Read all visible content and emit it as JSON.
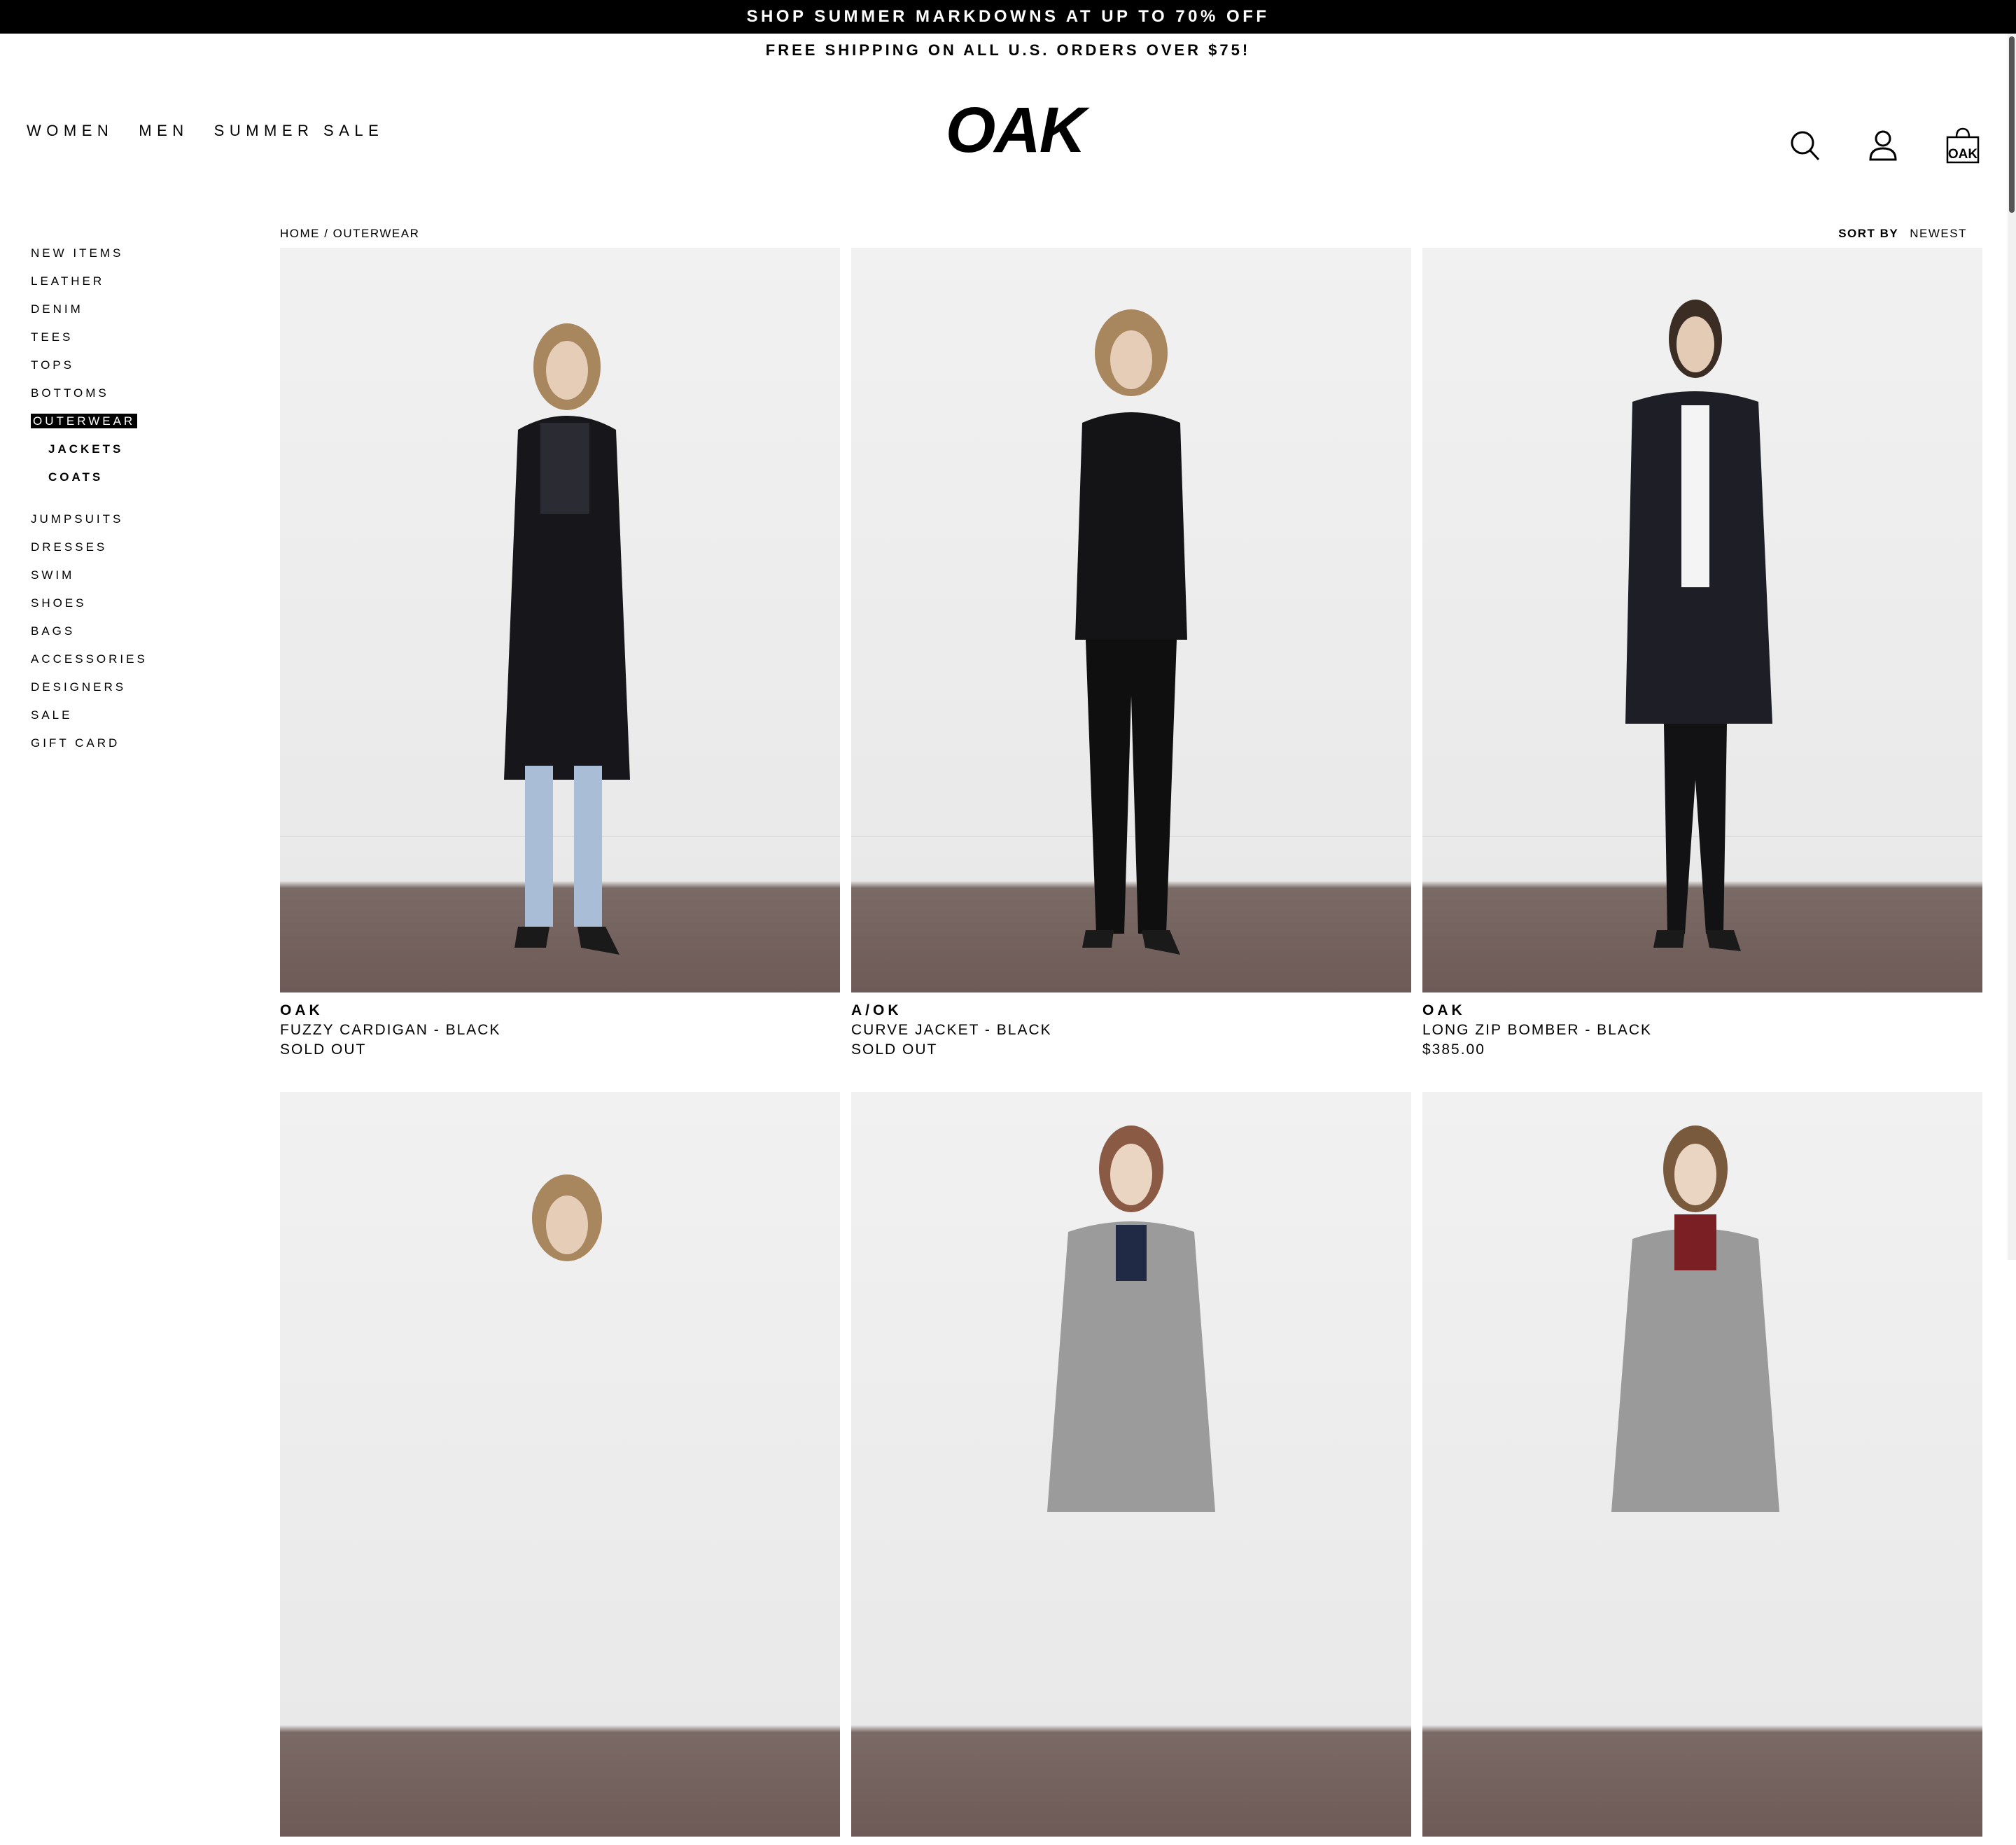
{
  "promo": {
    "top": "SHOP SUMMER MARKDOWNS AT UP TO 70% OFF",
    "sub": "FREE SHIPPING ON ALL U.S. ORDERS OVER $75!"
  },
  "nav": [
    "WOMEN",
    "MEN",
    "SUMMER SALE"
  ],
  "logo": "OAK",
  "header_icons": [
    "search-icon",
    "account-icon",
    "cart-icon"
  ],
  "cart_bag_text": "OAK",
  "sidebar": {
    "items": [
      "NEW ITEMS",
      "LEATHER",
      "DENIM",
      "TEES",
      "TOPS",
      "BOTTOMS"
    ],
    "active": "OUTERWEAR",
    "subitems": [
      "JACKETS",
      "COATS"
    ],
    "items_after": [
      "JUMPSUITS",
      "DRESSES",
      "SWIM",
      "SHOES",
      "BAGS",
      "ACCESSORIES",
      "DESIGNERS",
      "SALE",
      "GIFT CARD"
    ]
  },
  "breadcrumb": {
    "home": "HOME",
    "separator": " / ",
    "current": "OUTERWEAR"
  },
  "sort": {
    "label": "SORT BY",
    "value": "NEWEST"
  },
  "products": [
    {
      "brand": "OAK",
      "name": "FUZZY CARDIGAN - BLACK",
      "price": "SOLD OUT"
    },
    {
      "brand": "A/OK",
      "name": "CURVE JACKET - BLACK",
      "price": "SOLD OUT"
    },
    {
      "brand": "OAK",
      "name": "LONG ZIP BOMBER - BLACK",
      "price": "$385.00"
    },
    {
      "brand": "",
      "name": "",
      "price": ""
    },
    {
      "brand": "",
      "name": "",
      "price": ""
    },
    {
      "brand": "",
      "name": "",
      "price": ""
    }
  ],
  "colors": {
    "accent": "#000000",
    "background": "#ffffff",
    "wall": "#f1f1f1",
    "floor": "#6e5a56"
  }
}
